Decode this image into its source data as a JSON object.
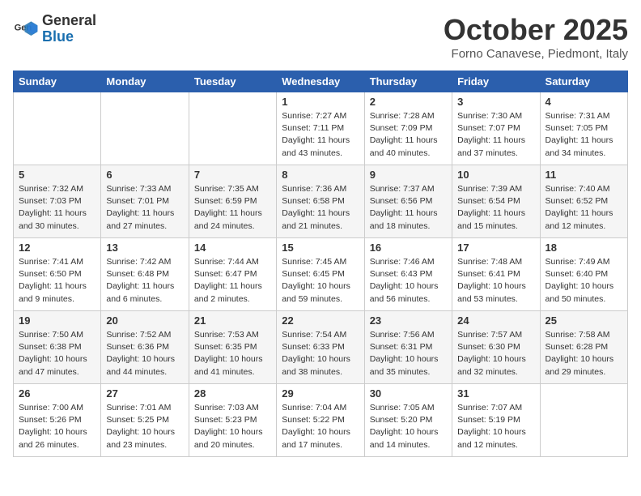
{
  "header": {
    "logo_general": "General",
    "logo_blue": "Blue",
    "title": "October 2025",
    "location": "Forno Canavese, Piedmont, Italy"
  },
  "weekdays": [
    "Sunday",
    "Monday",
    "Tuesday",
    "Wednesday",
    "Thursday",
    "Friday",
    "Saturday"
  ],
  "weeks": [
    [
      {
        "day": "",
        "info": ""
      },
      {
        "day": "",
        "info": ""
      },
      {
        "day": "",
        "info": ""
      },
      {
        "day": "1",
        "info": "Sunrise: 7:27 AM\nSunset: 7:11 PM\nDaylight: 11 hours and 43 minutes."
      },
      {
        "day": "2",
        "info": "Sunrise: 7:28 AM\nSunset: 7:09 PM\nDaylight: 11 hours and 40 minutes."
      },
      {
        "day": "3",
        "info": "Sunrise: 7:30 AM\nSunset: 7:07 PM\nDaylight: 11 hours and 37 minutes."
      },
      {
        "day": "4",
        "info": "Sunrise: 7:31 AM\nSunset: 7:05 PM\nDaylight: 11 hours and 34 minutes."
      }
    ],
    [
      {
        "day": "5",
        "info": "Sunrise: 7:32 AM\nSunset: 7:03 PM\nDaylight: 11 hours and 30 minutes."
      },
      {
        "day": "6",
        "info": "Sunrise: 7:33 AM\nSunset: 7:01 PM\nDaylight: 11 hours and 27 minutes."
      },
      {
        "day": "7",
        "info": "Sunrise: 7:35 AM\nSunset: 6:59 PM\nDaylight: 11 hours and 24 minutes."
      },
      {
        "day": "8",
        "info": "Sunrise: 7:36 AM\nSunset: 6:58 PM\nDaylight: 11 hours and 21 minutes."
      },
      {
        "day": "9",
        "info": "Sunrise: 7:37 AM\nSunset: 6:56 PM\nDaylight: 11 hours and 18 minutes."
      },
      {
        "day": "10",
        "info": "Sunrise: 7:39 AM\nSunset: 6:54 PM\nDaylight: 11 hours and 15 minutes."
      },
      {
        "day": "11",
        "info": "Sunrise: 7:40 AM\nSunset: 6:52 PM\nDaylight: 11 hours and 12 minutes."
      }
    ],
    [
      {
        "day": "12",
        "info": "Sunrise: 7:41 AM\nSunset: 6:50 PM\nDaylight: 11 hours and 9 minutes."
      },
      {
        "day": "13",
        "info": "Sunrise: 7:42 AM\nSunset: 6:48 PM\nDaylight: 11 hours and 6 minutes."
      },
      {
        "day": "14",
        "info": "Sunrise: 7:44 AM\nSunset: 6:47 PM\nDaylight: 11 hours and 2 minutes."
      },
      {
        "day": "15",
        "info": "Sunrise: 7:45 AM\nSunset: 6:45 PM\nDaylight: 10 hours and 59 minutes."
      },
      {
        "day": "16",
        "info": "Sunrise: 7:46 AM\nSunset: 6:43 PM\nDaylight: 10 hours and 56 minutes."
      },
      {
        "day": "17",
        "info": "Sunrise: 7:48 AM\nSunset: 6:41 PM\nDaylight: 10 hours and 53 minutes."
      },
      {
        "day": "18",
        "info": "Sunrise: 7:49 AM\nSunset: 6:40 PM\nDaylight: 10 hours and 50 minutes."
      }
    ],
    [
      {
        "day": "19",
        "info": "Sunrise: 7:50 AM\nSunset: 6:38 PM\nDaylight: 10 hours and 47 minutes."
      },
      {
        "day": "20",
        "info": "Sunrise: 7:52 AM\nSunset: 6:36 PM\nDaylight: 10 hours and 44 minutes."
      },
      {
        "day": "21",
        "info": "Sunrise: 7:53 AM\nSunset: 6:35 PM\nDaylight: 10 hours and 41 minutes."
      },
      {
        "day": "22",
        "info": "Sunrise: 7:54 AM\nSunset: 6:33 PM\nDaylight: 10 hours and 38 minutes."
      },
      {
        "day": "23",
        "info": "Sunrise: 7:56 AM\nSunset: 6:31 PM\nDaylight: 10 hours and 35 minutes."
      },
      {
        "day": "24",
        "info": "Sunrise: 7:57 AM\nSunset: 6:30 PM\nDaylight: 10 hours and 32 minutes."
      },
      {
        "day": "25",
        "info": "Sunrise: 7:58 AM\nSunset: 6:28 PM\nDaylight: 10 hours and 29 minutes."
      }
    ],
    [
      {
        "day": "26",
        "info": "Sunrise: 7:00 AM\nSunset: 5:26 PM\nDaylight: 10 hours and 26 minutes."
      },
      {
        "day": "27",
        "info": "Sunrise: 7:01 AM\nSunset: 5:25 PM\nDaylight: 10 hours and 23 minutes."
      },
      {
        "day": "28",
        "info": "Sunrise: 7:03 AM\nSunset: 5:23 PM\nDaylight: 10 hours and 20 minutes."
      },
      {
        "day": "29",
        "info": "Sunrise: 7:04 AM\nSunset: 5:22 PM\nDaylight: 10 hours and 17 minutes."
      },
      {
        "day": "30",
        "info": "Sunrise: 7:05 AM\nSunset: 5:20 PM\nDaylight: 10 hours and 14 minutes."
      },
      {
        "day": "31",
        "info": "Sunrise: 7:07 AM\nSunset: 5:19 PM\nDaylight: 10 hours and 12 minutes."
      },
      {
        "day": "",
        "info": ""
      }
    ]
  ]
}
